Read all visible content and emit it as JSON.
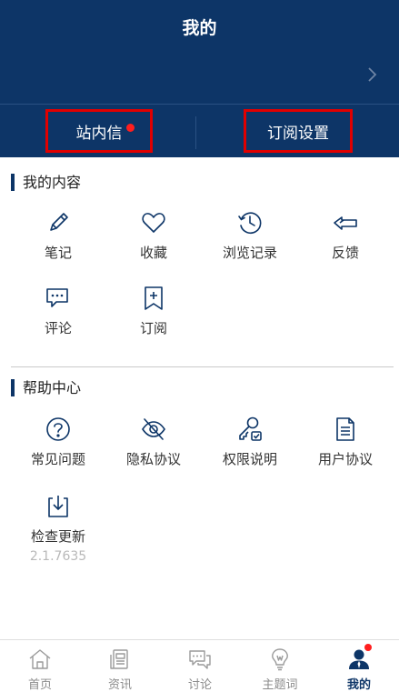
{
  "header": {
    "title": "我的",
    "tabs": [
      {
        "label": "站内信",
        "has_unread_dot": true
      },
      {
        "label": "订阅设置"
      }
    ]
  },
  "my_content": {
    "title": "我的内容",
    "items": [
      {
        "label": "笔记",
        "icon": "pencil-icon"
      },
      {
        "label": "收藏",
        "icon": "heart-icon"
      },
      {
        "label": "浏览记录",
        "icon": "history-icon"
      },
      {
        "label": "反馈",
        "icon": "feedback-icon"
      },
      {
        "label": "评论",
        "icon": "comment-icon"
      },
      {
        "label": "订阅",
        "icon": "bookmark-add-icon"
      }
    ]
  },
  "help_center": {
    "title": "帮助中心",
    "items": [
      {
        "label": "常见问题",
        "icon": "question-icon"
      },
      {
        "label": "隐私协议",
        "icon": "eye-off-icon"
      },
      {
        "label": "权限说明",
        "icon": "key-icon"
      },
      {
        "label": "用户协议",
        "icon": "document-icon"
      },
      {
        "label": "检查更新",
        "icon": "download-icon",
        "sub": "2.1.7635"
      }
    ]
  },
  "tabbar": {
    "items": [
      {
        "label": "首页",
        "icon": "home-icon"
      },
      {
        "label": "资讯",
        "icon": "news-icon"
      },
      {
        "label": "讨论",
        "icon": "discussion-icon"
      },
      {
        "label": "主题词",
        "icon": "topic-icon"
      },
      {
        "label": "我的",
        "icon": "user-icon",
        "active": true,
        "has_dot": true
      }
    ]
  },
  "colors": {
    "primary": "#0d3567",
    "highlight_box": "#e00000",
    "dot": "#ff1e1e"
  }
}
